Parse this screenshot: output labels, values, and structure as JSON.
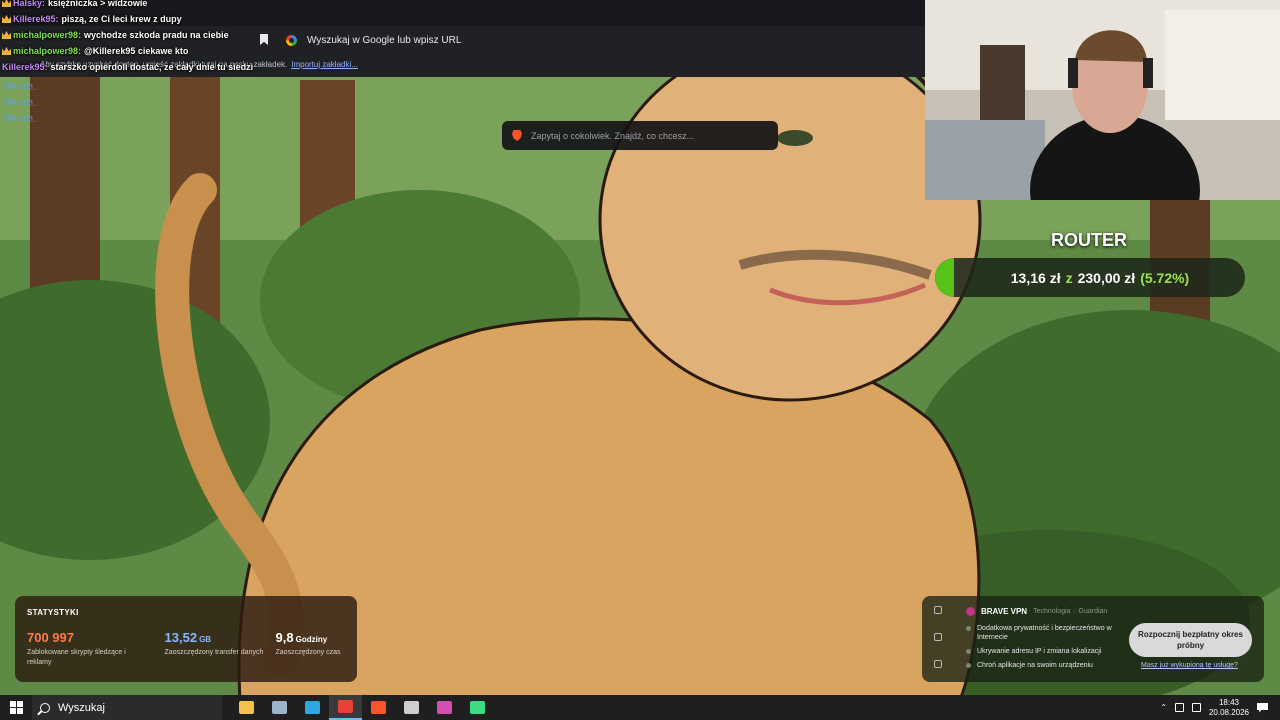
{
  "browser": {
    "url_placeholder": "Wyszukaj w Google lub wpisz URL",
    "bookmarks_hint": "Aby szybko uzyskać dostęp, umieść zakładki tutaj na pasku zakładek.",
    "import_bookmarks_label": "Importuj zakładki...",
    "ask_placeholder": "Zapytaj o cokolwiek. Znajdź, co chcesz..."
  },
  "chat": [
    {
      "user": "Halsky:",
      "text": "księżniczka > widzowie",
      "badge": true,
      "user_color": "alt"
    },
    {
      "user": "Killerek95:",
      "text": "piszą, ze Ci leci krew z dupy",
      "badge": true,
      "user_color": "alt"
    },
    {
      "user": "michalpower98:",
      "text": "wychodze szkoda pradu na ciebie",
      "badge": true,
      "user_color": "green"
    },
    {
      "user": "michalpower98:",
      "text": "@Killerek95 ciekawe kto",
      "badge": true,
      "user_color": "green"
    },
    {
      "user": "Killerek95:",
      "text": "starszko opierdoli dostać, ze cały dnie tu siedzi",
      "badge": false,
      "user_color": "alt"
    }
  ],
  "chat_faded": [
    "Marvin_",
    "Marvin_",
    "Marvin_"
  ],
  "goal": {
    "title": "ROUTER",
    "current": "13,16 zł",
    "separator": "z",
    "target": "230,00 zł",
    "percent_label": "(5.72%)",
    "fill_fraction": 0.0572,
    "fill_color": "#56c21a"
  },
  "stats": {
    "title": "STATYSTYKI",
    "items": [
      {
        "value": "700 997",
        "unit": "",
        "label": "Zablokowane skrypty śledzące i reklamy",
        "color": "orange"
      },
      {
        "value": "13,52",
        "unit": "GB",
        "label": "Zaoszczędzony transfer danych",
        "color": "blue"
      },
      {
        "value": "9,8",
        "unit": "Godziny",
        "label": "Zaoszczędzony czas",
        "color": "white"
      }
    ]
  },
  "vpn": {
    "name": "BRAVE VPN",
    "tagline": "Technologia ◌ Guardian",
    "features": [
      "Dodatkowa prywatność i bezpieczeństwo w Internecie",
      "Ukrywanie adresu IP i zmiana lokalizacji",
      "Chroń aplikacje na swoim urządzeniu"
    ],
    "cta_label": "Rozpocznij bezpłatny okres próbny",
    "already_bought_label": "Masz już wykupioną tę usługę?"
  },
  "taskbar": {
    "search_placeholder": "Wyszukaj",
    "apps": [
      {
        "icon": "folder-icon",
        "color": "#f2c14e"
      },
      {
        "icon": "files-icon",
        "color": "#9fb3c8"
      },
      {
        "icon": "edge-icon",
        "color": "#2fa7e3"
      },
      {
        "icon": "chrome-icon",
        "color": "#e94235"
      },
      {
        "icon": "brave-icon",
        "color": "#fb542b"
      },
      {
        "icon": "obs-icon",
        "color": "#cfcfcf"
      },
      {
        "icon": "image-icon",
        "color": "#d44fb0"
      },
      {
        "icon": "play-icon",
        "color": "#3ddc84"
      }
    ],
    "time": "18:43",
    "date": "20.08.2026"
  }
}
